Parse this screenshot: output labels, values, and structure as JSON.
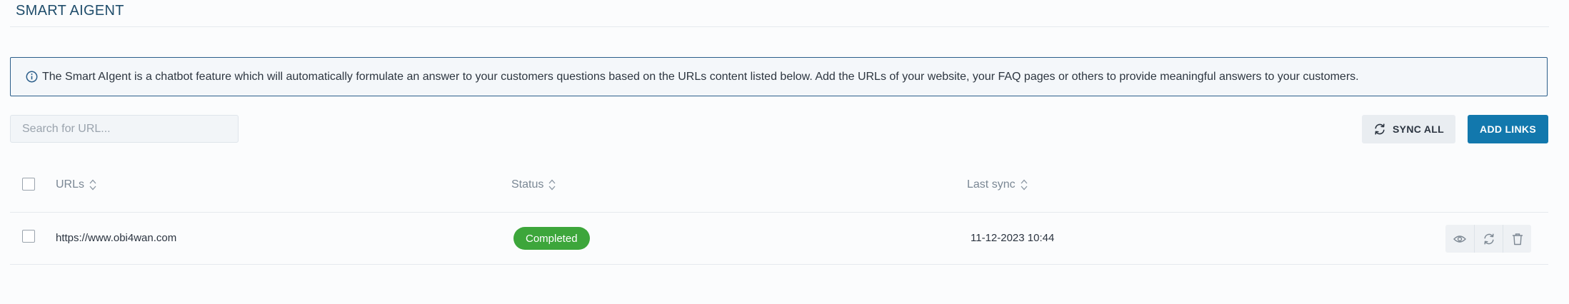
{
  "page": {
    "title": "SMART AIGENT"
  },
  "info": {
    "icon": "info-circle-icon",
    "text": "The Smart AIgent is a chatbot feature which will automatically formulate an answer to your customers questions based on the URLs content listed below. Add the URLs of your website, your FAQ pages or others to provide meaningful answers to your customers."
  },
  "search": {
    "placeholder": "Search for URL...",
    "value": ""
  },
  "toolbar": {
    "sync_all_label": "SYNC ALL",
    "sync_icon": "refresh-icon",
    "add_links_label": "ADD LINKS"
  },
  "table": {
    "columns": [
      "URLs",
      "Status",
      "Last sync"
    ],
    "rows": [
      {
        "url": "https://www.obi4wan.com",
        "status": "Completed",
        "last_sync": "11-12-2023 10:44",
        "actions": [
          "eye-icon",
          "refresh-icon",
          "trash-icon"
        ]
      }
    ]
  },
  "colors": {
    "accent": "#1278ad",
    "title": "#1f4d6b",
    "status_completed": "#3da63b",
    "banner_border": "#2b5e8a"
  }
}
